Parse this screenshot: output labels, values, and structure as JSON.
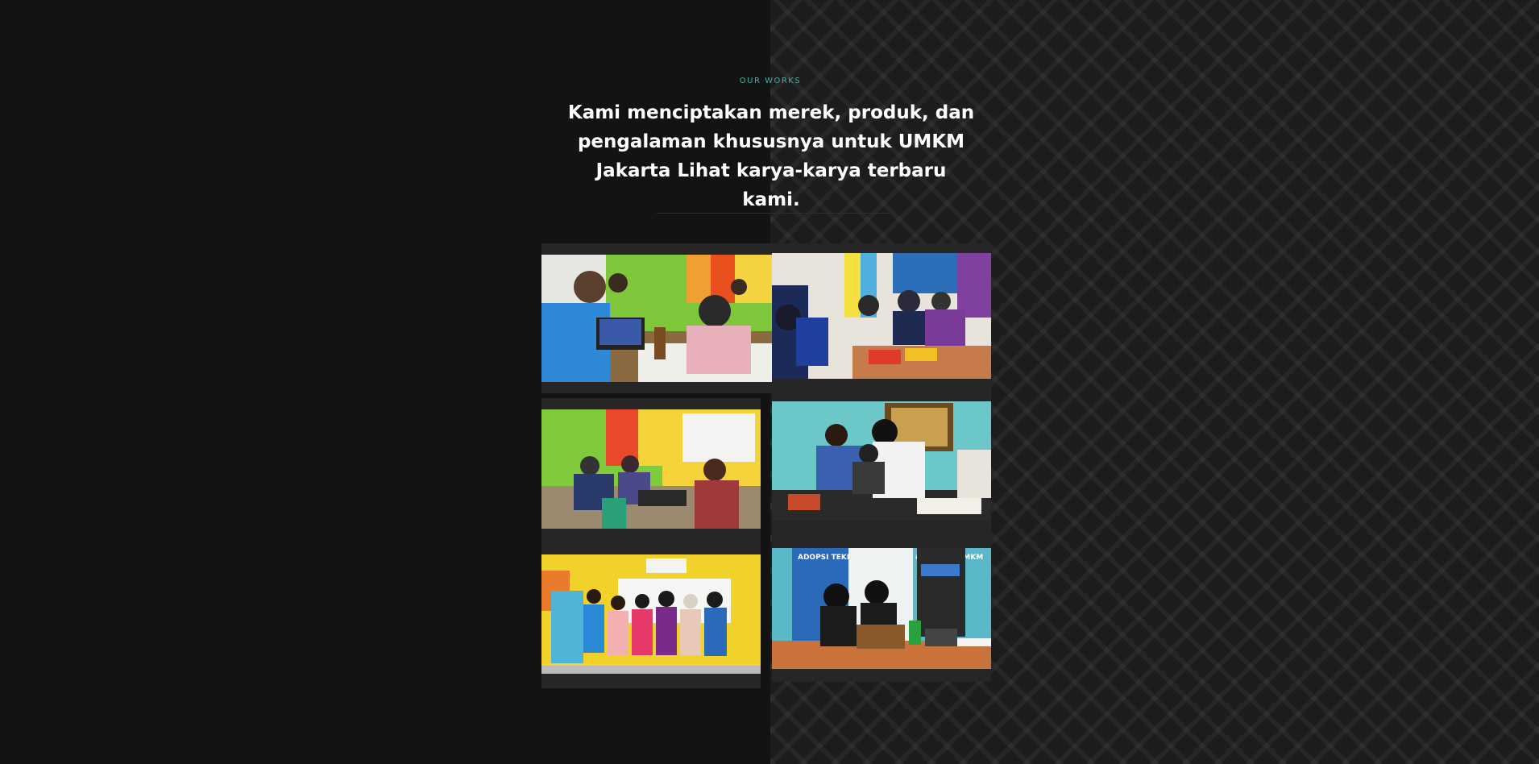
{
  "section": {
    "eyebrow": "OUR WORKS",
    "headline": "Kami menciptakan merek, produk, dan pengalaman khususnya untuk UMKM Jakarta Lihat karya-karya terbaru kami."
  },
  "gallery": {
    "items": [
      {
        "name": "workshop-photo-1",
        "scene": "meeting-laptop"
      },
      {
        "name": "workshop-photo-2",
        "scene": "group-table"
      },
      {
        "name": "workshop-photo-3",
        "scene": "classroom"
      },
      {
        "name": "workshop-photo-4",
        "scene": "computer-session"
      },
      {
        "name": "workshop-photo-5",
        "scene": "group-pose"
      },
      {
        "name": "workshop-photo-6",
        "scene": "product-display"
      }
    ],
    "banner_text": "ADOPSI TEKNOLOGI DIGITAL & AI BAGI UMKM"
  },
  "colors": {
    "background": "#131313",
    "accent": "#43b3a4",
    "heading": "#ffffff"
  }
}
